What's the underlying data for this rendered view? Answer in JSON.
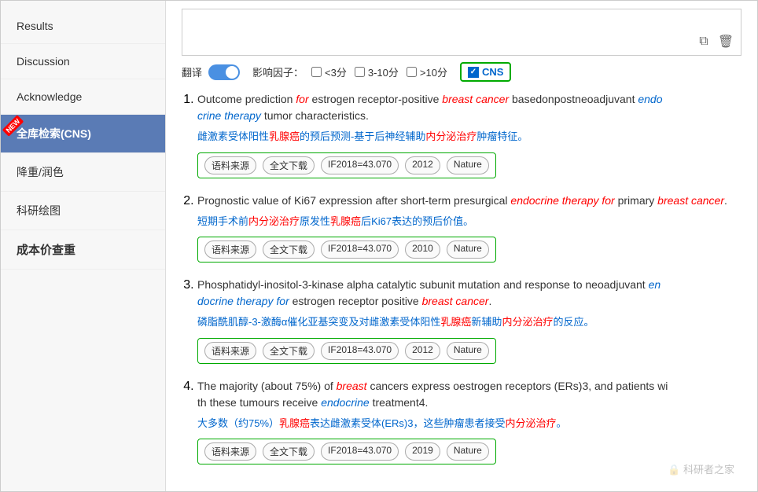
{
  "sidebar": {
    "items": [
      {
        "id": "results",
        "label": "Results",
        "active": false,
        "bold": false,
        "new": false
      },
      {
        "id": "discussion",
        "label": "Discussion",
        "active": false,
        "bold": false,
        "new": false
      },
      {
        "id": "acknowledge",
        "label": "Acknowledge",
        "active": false,
        "bold": false,
        "new": false
      },
      {
        "id": "cns-search",
        "label": "全库检索(CNS)",
        "active": true,
        "bold": false,
        "new": true
      },
      {
        "id": "recolor",
        "label": "降重/润色",
        "active": false,
        "bold": false,
        "new": false
      },
      {
        "id": "chart",
        "label": "科研绘图",
        "active": false,
        "bold": false,
        "new": false
      },
      {
        "id": "cost",
        "label": "成本价查重",
        "active": false,
        "bold": true,
        "new": false
      }
    ]
  },
  "toolbar": {
    "translate_label": "翻译",
    "impact_label": "影响因子：",
    "filters": [
      {
        "label": "<3分",
        "checked": false
      },
      {
        "label": "3-10分",
        "checked": false
      },
      {
        "label": ">10分",
        "checked": false
      }
    ],
    "cns_label": "CNS",
    "cns_checked": true
  },
  "results": [
    {
      "number": 1,
      "title_parts": [
        {
          "text": "Outcome prediction ",
          "type": "normal"
        },
        {
          "text": "for",
          "type": "italic-red"
        },
        {
          "text": " estrogen receptor-positive ",
          "type": "normal"
        },
        {
          "text": "breast cancer",
          "type": "italic-red"
        },
        {
          "text": " basedonpostneoadjuvant ",
          "type": "normal"
        },
        {
          "text": "endocrine therapy",
          "type": "italic-blue"
        },
        {
          "text": " tumor characteristics.",
          "type": "normal"
        }
      ],
      "translation": "雌激素受体阳性乳腺癌的预后预测-基于后辅神经辅助内分泌治疗肿瘤特征。",
      "tags": [
        "语料来源",
        "全文下载",
        "IF2018=43.070",
        "2012",
        "Nature"
      ]
    },
    {
      "number": 2,
      "title_parts": [
        {
          "text": "Prognostic value of Ki67 expression after short-term presurgical ",
          "type": "normal"
        },
        {
          "text": "endocrine therapy for",
          "type": "italic-red"
        },
        {
          "text": " primary ",
          "type": "normal"
        },
        {
          "text": "breast cancer",
          "type": "italic-red"
        },
        {
          "text": ".",
          "type": "normal"
        }
      ],
      "translation": "短期手术前内分泌治疗原发性乳腺癌后Ki67表达的预后价值。",
      "tags": [
        "语料来源",
        "全文下载",
        "IF2018=43.070",
        "2010",
        "Nature"
      ]
    },
    {
      "number": 3,
      "title_parts": [
        {
          "text": "Phosphatidyl-inositol-3-kinase alpha catalytic subunit mutation and response to neoadjuvant ",
          "type": "normal"
        },
        {
          "text": "endocrine therapy for",
          "type": "italic-blue"
        },
        {
          "text": " estrogen receptor positive ",
          "type": "normal"
        },
        {
          "text": "breast cancer",
          "type": "italic-red"
        },
        {
          "text": ".",
          "type": "normal"
        }
      ],
      "translation": "磷脂酰肌醇-3-激酶α催化亚基突变及对雌激素受体阳性乳腺癌新辅助内分泌治疗的反应。",
      "tags": [
        "语料来源",
        "全文下载",
        "IF2018=43.070",
        "2012",
        "Nature"
      ]
    },
    {
      "number": 4,
      "title_parts": [
        {
          "text": "The majority (about 75%) of ",
          "type": "normal"
        },
        {
          "text": "breast",
          "type": "italic-red"
        },
        {
          "text": " cancers express oestrogen receptors (ERs)3, and patients with these tumours receive ",
          "type": "normal"
        },
        {
          "text": "endocrine",
          "type": "italic-blue"
        },
        {
          "text": " treatment4.",
          "type": "normal"
        }
      ],
      "translation": "大多数（约75%）乳腺癌表达雌激素受体(ERs)3，这些肿瘤患者接受内分泌治疗。",
      "tags": [
        "语料来源",
        "全文下载",
        "IF2018=43.070",
        "2019",
        "Nature"
      ]
    }
  ],
  "watermark": "科研者之家"
}
